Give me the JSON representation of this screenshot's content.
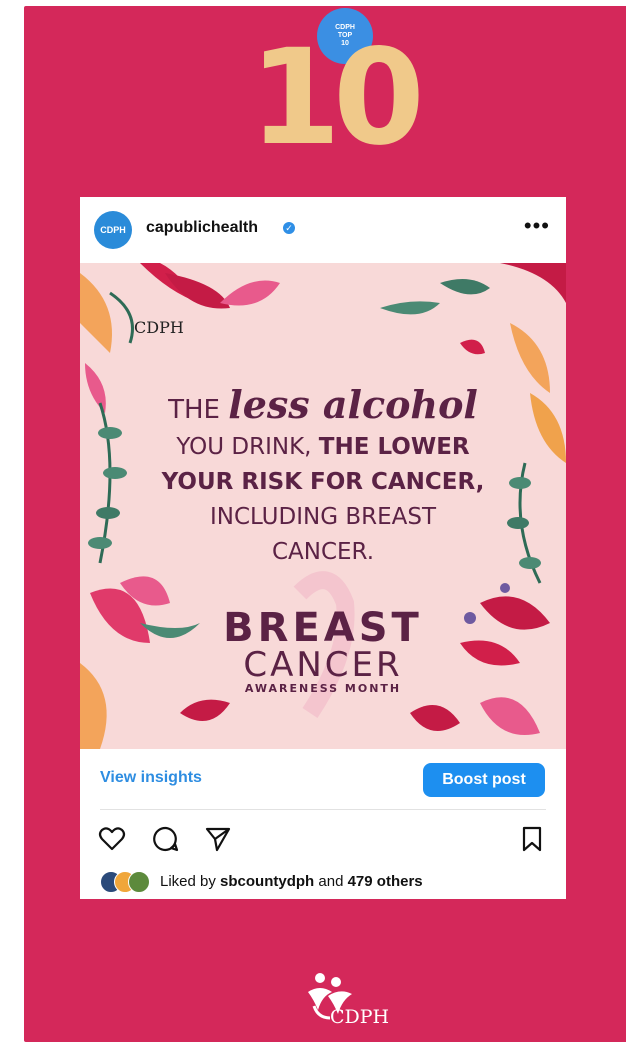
{
  "badge": {
    "line1": "CDPH",
    "line2": "TOP",
    "line3": "10"
  },
  "rank_number": "10",
  "post": {
    "username": "capublichealth",
    "avatar_text": "CDPH",
    "more_label": "•••",
    "image": {
      "logo_text": "CDPH",
      "message": {
        "w1": "THE",
        "w2": "less alcohol",
        "l2a": "YOU DRINK,",
        "l2b": "THE LOWER",
        "l3": "YOUR RISK FOR CANCER,",
        "l4": "INCLUDING BREAST",
        "l5": "CANCER."
      },
      "campaign": {
        "t1": "BREAST",
        "t2": "CANCER",
        "t3": "AWARENESS MONTH"
      }
    },
    "view_insights": "View insights",
    "boost_post": "Boost post",
    "likes": {
      "prefix": "Liked by",
      "user": "sbcountydph",
      "middle": "and",
      "count": "479 others"
    }
  },
  "footer_logo_text": "CDPH",
  "colors": {
    "background": "#d4285a",
    "number": "#f0c98a",
    "accent": "#1d8ff0",
    "image_bg": "#f8d9d8",
    "text_dark": "#5b2245"
  }
}
